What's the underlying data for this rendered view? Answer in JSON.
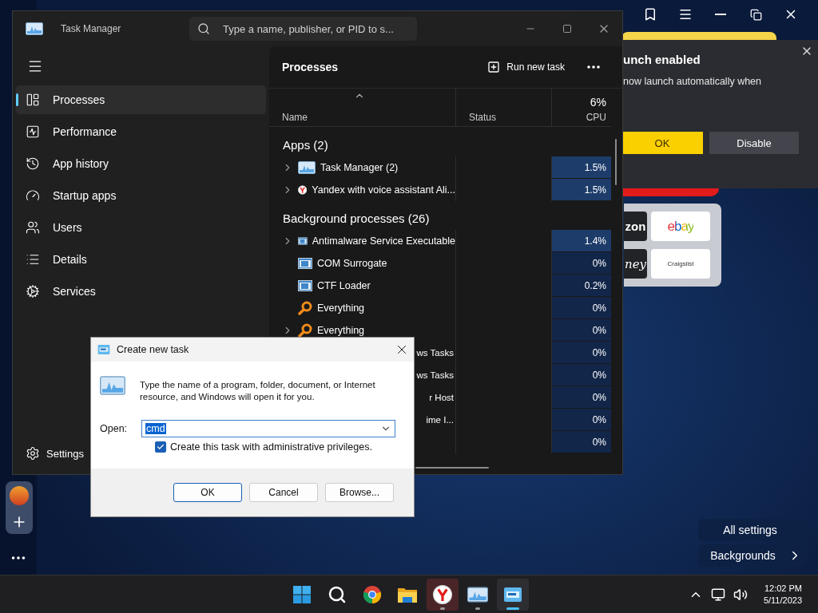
{
  "browser": {
    "popup": {
      "title": "unch enabled",
      "body": "now launch automatically when",
      "buttons": [
        {
          "label": "OK",
          "kind": "primary"
        },
        {
          "label": "Disable",
          "kind": "secondary"
        }
      ]
    },
    "tiles": [
      {
        "label": "zon",
        "kind": "dark"
      },
      {
        "label": "ebay",
        "kind": "logo"
      },
      {
        "label": "ney",
        "kind": "script"
      },
      {
        "label": "Craigslist",
        "kind": "light"
      }
    ],
    "settings_buttons": [
      {
        "label": "All settings",
        "kind": "plain"
      },
      {
        "label": "Backgrounds",
        "kind": "more"
      }
    ]
  },
  "task_manager": {
    "title": "Task Manager",
    "search": {
      "placeholder": "Type a name, publisher, or PID to s..."
    },
    "nav": [
      {
        "label": "Processes",
        "kind": "processes",
        "selected": true
      },
      {
        "label": "Performance",
        "kind": "performance",
        "selected": false
      },
      {
        "label": "App history",
        "kind": "history",
        "selected": false
      },
      {
        "label": "Startup apps",
        "kind": "startup",
        "selected": false
      },
      {
        "label": "Users",
        "kind": "users",
        "selected": false
      },
      {
        "label": "Details",
        "kind": "details",
        "selected": false
      },
      {
        "label": "Services",
        "kind": "services",
        "selected": false
      }
    ],
    "settings_label": "Settings",
    "page_title": "Processes",
    "run_button": "Run new task",
    "columns": [
      {
        "label": "Name"
      },
      {
        "label": "Status"
      },
      {
        "label": "CPU",
        "total": "6%"
      }
    ],
    "rows": [
      {
        "kind": "group",
        "name": "Apps (2)"
      },
      {
        "kind": "monitor",
        "name": "Task Manager (2)",
        "expandable": true,
        "cpu": "1.5%",
        "highlight": true
      },
      {
        "kind": "browser",
        "name": "Yandex with voice assistant Ali...",
        "expandable": true,
        "cpu": "1.5%",
        "highlight": true
      },
      {
        "kind": "group",
        "name": "Background processes (26)"
      },
      {
        "kind": "service",
        "name": "Antimalware Service Executable",
        "expandable": true,
        "cpu": "1.4%",
        "highlight": true
      },
      {
        "kind": "service",
        "name": "COM Surrogate",
        "expandable": false,
        "cpu": "0%",
        "highlight": false
      },
      {
        "kind": "service",
        "name": "CTF Loader",
        "expandable": false,
        "cpu": "0.2%",
        "highlight": false
      },
      {
        "kind": "finder",
        "name": "Everything",
        "expandable": false,
        "cpu": "0%",
        "highlight": false
      },
      {
        "kind": "finder",
        "name": "Everything",
        "expandable": true,
        "cpu": "0%",
        "highlight": false
      },
      {
        "kind": "covered",
        "name": "ws Tasks",
        "cpu": "0%",
        "highlight": false
      },
      {
        "kind": "covered",
        "name": "ws Tasks",
        "cpu": "0%",
        "highlight": false
      },
      {
        "kind": "covered",
        "name": "r Host",
        "cpu": "0%",
        "highlight": false
      },
      {
        "kind": "covered",
        "name": "ime I...",
        "cpu": "0%",
        "highlight": false
      },
      {
        "kind": "covered",
        "cpu": "0%",
        "highlight": false
      }
    ]
  },
  "dialog": {
    "title": "Create new task",
    "message": "Type the name of a program, folder, document, or Internet resource, and Windows will open it for you.",
    "open_label": "Open:",
    "open_value": "cmd",
    "admin": {
      "label": "Create this task with administrative privileges.",
      "checked": true
    },
    "buttons": [
      {
        "label": "OK",
        "selected": true
      },
      {
        "label": "Cancel",
        "selected": false
      },
      {
        "label": "Browse...",
        "selected": false
      }
    ]
  },
  "taskbar": {
    "apps": [
      {
        "kind": "start",
        "hovered": false,
        "running": false,
        "selected": false
      },
      {
        "kind": "search",
        "hovered": false,
        "running": false,
        "selected": false
      },
      {
        "kind": "chrome",
        "hovered": false,
        "running": false,
        "selected": false
      },
      {
        "kind": "folder",
        "hovered": false,
        "running": false,
        "selected": false
      },
      {
        "kind": "yandex",
        "hovered": true,
        "running": true,
        "selected": false
      },
      {
        "kind": "monitor",
        "hovered": false,
        "running": true,
        "selected": false
      },
      {
        "kind": "run",
        "hovered": false,
        "running": true,
        "selected": true
      }
    ],
    "time": "12:02 PM",
    "date": "5/11/2023"
  }
}
